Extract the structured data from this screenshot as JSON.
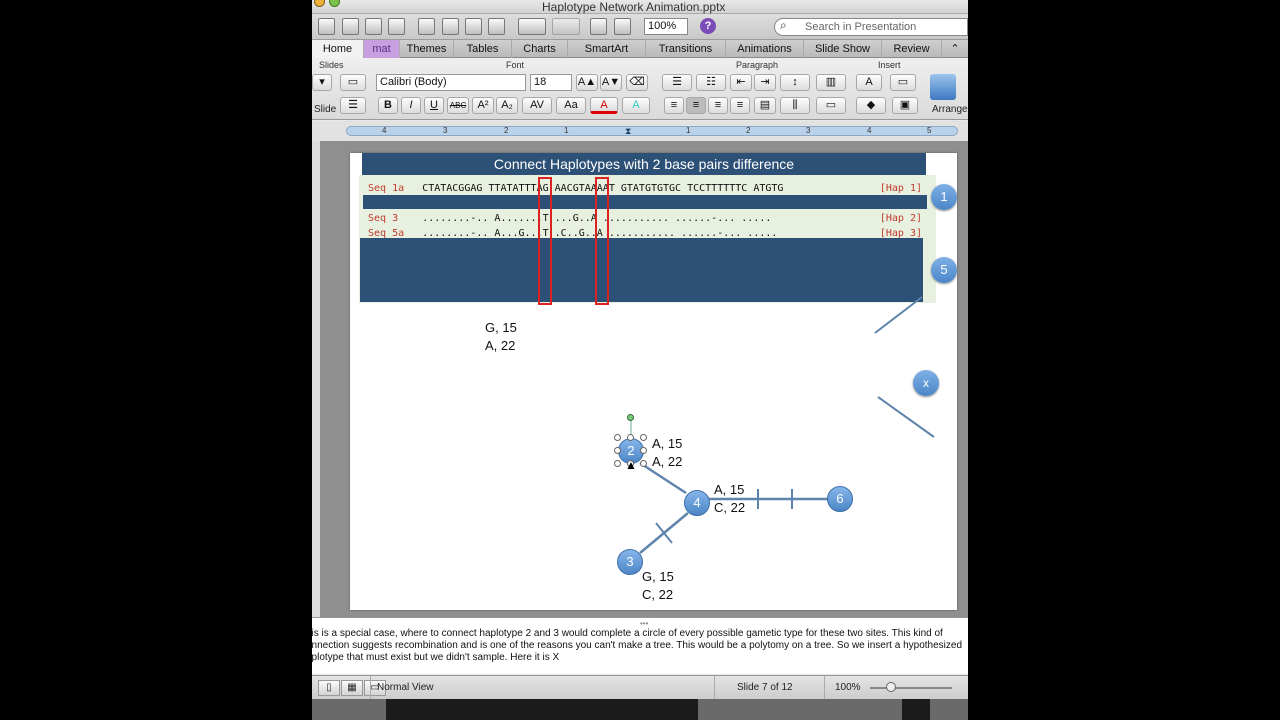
{
  "window": {
    "title": "Haplotype Network Animation.pptx"
  },
  "toolbar": {
    "zoom": "100%",
    "search_placeholder": "Search in Presentation"
  },
  "ribbon": {
    "tabs": [
      "Home",
      "mat",
      "Themes",
      "Tables",
      "Charts",
      "SmartArt",
      "Transitions",
      "Animations",
      "Slide Show",
      "Review"
    ],
    "groups": {
      "slides": "Slides",
      "font": "Font",
      "paragraph": "Paragraph",
      "insert": "Insert"
    },
    "slide_label": "Slide",
    "font_name": "Calibri (Body)",
    "font_size": "18",
    "arrange_label": "Arrange",
    "buttons": {
      "bold": "B",
      "italic": "I",
      "underline": "U",
      "strike": "ABC",
      "superscript": "A²",
      "subscript": "A₂",
      "font_color": "A",
      "grow": "A▲",
      "shrink": "A▼"
    }
  },
  "ruler": {
    "ticks": [
      "4",
      "3",
      "2",
      "1",
      "0",
      "1",
      "2",
      "3",
      "4",
      "5"
    ]
  },
  "slide": {
    "title": "Connect Haplotypes with 2 base pairs difference",
    "sequences": [
      {
        "name": "Seq 1a",
        "seq": "CTATACGGAG TTATATTTAG AACGTAAAAT GTATGTGTGC TCCTTTTTTC ATGTG",
        "hap": "[Hap 1]"
      },
      {
        "name": "Seq 3 ",
        "seq": "........-.. A.......T ...G..A ........... ......-... .....",
        "hap": "[Hap 2]"
      },
      {
        "name": "Seq 5a",
        "seq": "........-.. A...G...T .C..G..A ........... ......-... .....",
        "hap": "[Hap 3]"
      }
    ],
    "side_labels": [
      "1",
      "5",
      "x"
    ],
    "annotations": {
      "top": [
        "G, 15",
        "A, 22"
      ],
      "node2": [
        "A, 15",
        "A, 22"
      ],
      "node4": [
        "A, 15",
        "C, 22"
      ],
      "node3": [
        "G, 15",
        "C, 22"
      ]
    },
    "nodes": [
      "2",
      "4",
      "6",
      "3"
    ]
  },
  "notes": {
    "text": "his is a special case, where to connect haplotype 2 and 3 would complete a circle of every possible gametic type for these two sites. This kind of onnection suggests recombination and is one of the reasons you can't make a tree. This would be a polytomy on a tree. So we insert a hypothesized aplotype that must exist but we didn't sample. Here it is X"
  },
  "status": {
    "view": "Normal View",
    "slide_counter": "Slide 7 of 12",
    "zoom": "100%"
  },
  "colors": {
    "title_bar": "#2d5077",
    "node_fill": "#5b93d1",
    "seq_bg": "#e8f1e0",
    "highlight": "#dd2222",
    "format_tab": "#c8a0e0"
  }
}
